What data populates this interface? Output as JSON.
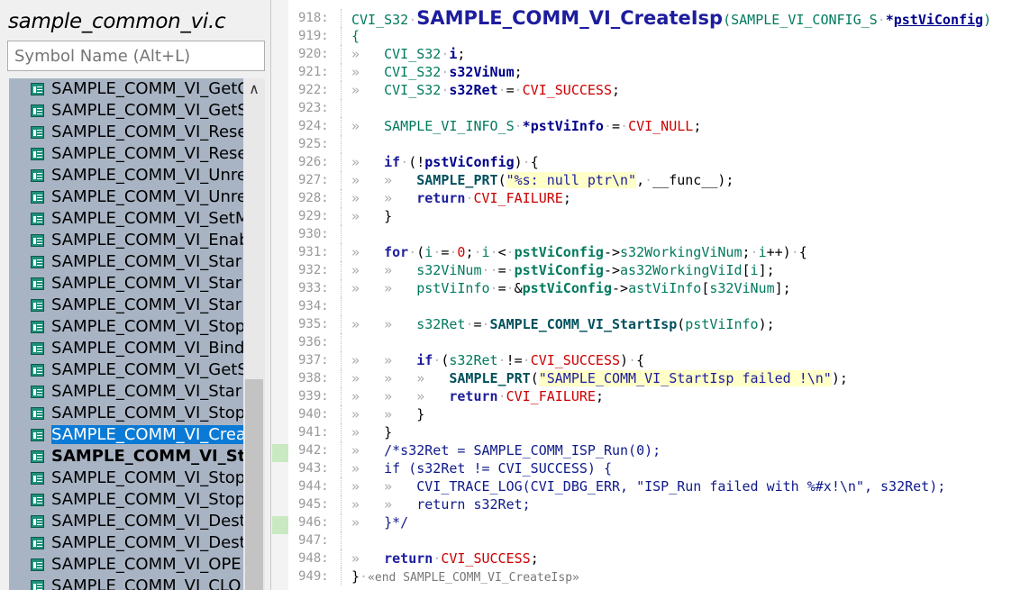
{
  "left_panel": {
    "file_title": "sample_common_vi.c",
    "search_placeholder": "Symbol Name (Alt+L)",
    "symbols": [
      {
        "name": "SAMPLE_COMM_VI_GetC",
        "state": "normal"
      },
      {
        "name": "SAMPLE_COMM_VI_GetS",
        "state": "normal"
      },
      {
        "name": "SAMPLE_COMM_VI_Rese",
        "state": "normal"
      },
      {
        "name": "SAMPLE_COMM_VI_Rese",
        "state": "normal"
      },
      {
        "name": "SAMPLE_COMM_VI_Unre",
        "state": "normal"
      },
      {
        "name": "SAMPLE_COMM_VI_Unre",
        "state": "normal"
      },
      {
        "name": "SAMPLE_COMM_VI_SetM",
        "state": "normal"
      },
      {
        "name": "SAMPLE_COMM_VI_Enab",
        "state": "normal"
      },
      {
        "name": "SAMPLE_COMM_VI_Star",
        "state": "normal"
      },
      {
        "name": "SAMPLE_COMM_VI_Star",
        "state": "normal"
      },
      {
        "name": "SAMPLE_COMM_VI_Star",
        "state": "normal"
      },
      {
        "name": "SAMPLE_COMM_VI_Stop",
        "state": "normal"
      },
      {
        "name": "SAMPLE_COMM_VI_Bind",
        "state": "normal"
      },
      {
        "name": "SAMPLE_COMM_VI_GetS",
        "state": "normal"
      },
      {
        "name": "SAMPLE_COMM_VI_Star",
        "state": "normal"
      },
      {
        "name": "SAMPLE_COMM_VI_Stop",
        "state": "normal"
      },
      {
        "name": "SAMPLE_COMM_VI_Crea",
        "state": "selected"
      },
      {
        "name": "SAMPLE_COMM_VI_Sta",
        "state": "bold"
      },
      {
        "name": "SAMPLE_COMM_VI_Stop",
        "state": "normal"
      },
      {
        "name": "SAMPLE_COMM_VI_Stop",
        "state": "normal"
      },
      {
        "name": "SAMPLE_COMM_VI_Dest",
        "state": "normal"
      },
      {
        "name": "SAMPLE_COMM_VI_Dest",
        "state": "normal"
      },
      {
        "name": "SAMPLE_COMM_VI_OPE",
        "state": "normal"
      },
      {
        "name": "SAMPLE_COMM_VI_CLO",
        "state": "normal"
      }
    ]
  },
  "editor": {
    "line_numbers": [
      "918:",
      "919:",
      "920:",
      "921:",
      "922:",
      "923:",
      "924:",
      "925:",
      "926:",
      "927:",
      "928:",
      "929:",
      "930:",
      "931:",
      "932:",
      "933:",
      "934:",
      "935:",
      "936:",
      "937:",
      "938:",
      "939:",
      "940:",
      "941:",
      "942:",
      "943:",
      "944:",
      "945:",
      "946:",
      "947:",
      "948:",
      "949:"
    ],
    "t": {
      "cvi_s32": "CVI_S32",
      "fn_name": "SAMPLE_COMM_VI_CreateIsp",
      "param_type": "SAMPLE_VI_CONFIG_S",
      "param_name": "pstViConfig",
      "open_brace": "{",
      "close_brace": "}",
      "var_i": "i",
      "var_num": "s32ViNum",
      "var_ret": "s32Ret",
      "cvi_success": "CVI_SUCCESS",
      "info_type": "SAMPLE_VI_INFO_S",
      "info_var": "pstViInfo",
      "cvi_null": "CVI_NULL",
      "kw_if": "if",
      "kw_for": "for",
      "kw_return": "return",
      "sample_prt": "SAMPLE_PRT",
      "str_null": "\"%s: null ptr\\n\"",
      "func_macro": "__func__",
      "cvi_failure": "CVI_FAILURE",
      "working_num": "s32WorkingViNum",
      "as_working": "as32WorkingViId",
      "ast_vi_info": "astViInfo",
      "start_isp": "SAMPLE_COMM_VI_StartIsp",
      "str_failed": "\"SAMPLE_COMM_VI_StartIsp failed !\\n\"",
      "c942": "/*s32Ret = SAMPLE_COMM_ISP_Run(0);",
      "c943": "if (s32Ret != CVI_SUCCESS) {",
      "c944": "CVI_TRACE_LOG(CVI_DBG_ERR, \"ISP_Run failed with %#x!\\n\", s32Ret);",
      "c945": "return s32Ret;",
      "c946": "}*/",
      "end_comment": "«end SAMPLE_COMM_VI_CreateIsp»"
    }
  }
}
